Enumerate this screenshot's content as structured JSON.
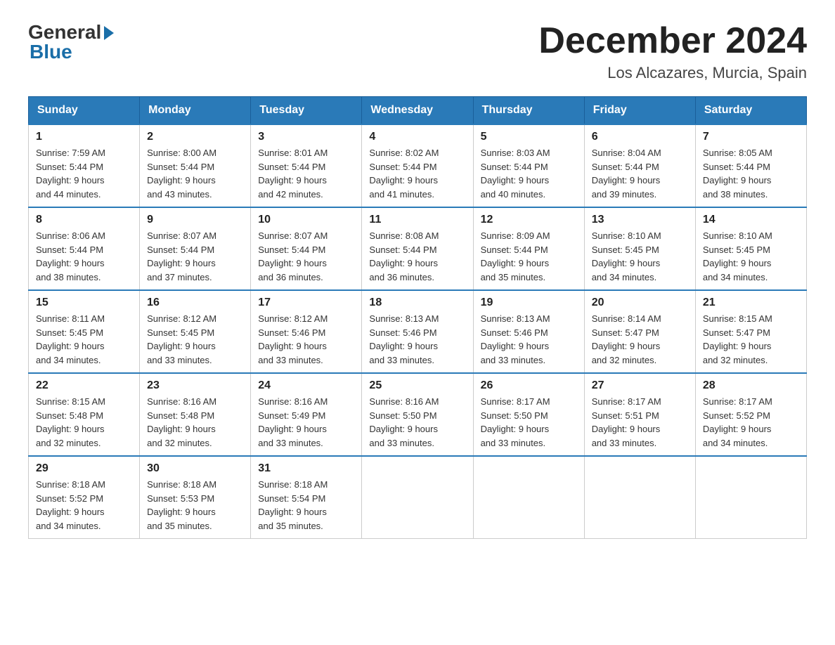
{
  "logo": {
    "general": "General",
    "blue": "Blue"
  },
  "header": {
    "month": "December 2024",
    "location": "Los Alcazares, Murcia, Spain"
  },
  "weekdays": [
    "Sunday",
    "Monday",
    "Tuesday",
    "Wednesday",
    "Thursday",
    "Friday",
    "Saturday"
  ],
  "weeks": [
    [
      {
        "day": "1",
        "sunrise": "7:59 AM",
        "sunset": "5:44 PM",
        "daylight": "9 hours and 44 minutes."
      },
      {
        "day": "2",
        "sunrise": "8:00 AM",
        "sunset": "5:44 PM",
        "daylight": "9 hours and 43 minutes."
      },
      {
        "day": "3",
        "sunrise": "8:01 AM",
        "sunset": "5:44 PM",
        "daylight": "9 hours and 42 minutes."
      },
      {
        "day": "4",
        "sunrise": "8:02 AM",
        "sunset": "5:44 PM",
        "daylight": "9 hours and 41 minutes."
      },
      {
        "day": "5",
        "sunrise": "8:03 AM",
        "sunset": "5:44 PM",
        "daylight": "9 hours and 40 minutes."
      },
      {
        "day": "6",
        "sunrise": "8:04 AM",
        "sunset": "5:44 PM",
        "daylight": "9 hours and 39 minutes."
      },
      {
        "day": "7",
        "sunrise": "8:05 AM",
        "sunset": "5:44 PM",
        "daylight": "9 hours and 38 minutes."
      }
    ],
    [
      {
        "day": "8",
        "sunrise": "8:06 AM",
        "sunset": "5:44 PM",
        "daylight": "9 hours and 38 minutes."
      },
      {
        "day": "9",
        "sunrise": "8:07 AM",
        "sunset": "5:44 PM",
        "daylight": "9 hours and 37 minutes."
      },
      {
        "day": "10",
        "sunrise": "8:07 AM",
        "sunset": "5:44 PM",
        "daylight": "9 hours and 36 minutes."
      },
      {
        "day": "11",
        "sunrise": "8:08 AM",
        "sunset": "5:44 PM",
        "daylight": "9 hours and 36 minutes."
      },
      {
        "day": "12",
        "sunrise": "8:09 AM",
        "sunset": "5:44 PM",
        "daylight": "9 hours and 35 minutes."
      },
      {
        "day": "13",
        "sunrise": "8:10 AM",
        "sunset": "5:45 PM",
        "daylight": "9 hours and 34 minutes."
      },
      {
        "day": "14",
        "sunrise": "8:10 AM",
        "sunset": "5:45 PM",
        "daylight": "9 hours and 34 minutes."
      }
    ],
    [
      {
        "day": "15",
        "sunrise": "8:11 AM",
        "sunset": "5:45 PM",
        "daylight": "9 hours and 34 minutes."
      },
      {
        "day": "16",
        "sunrise": "8:12 AM",
        "sunset": "5:45 PM",
        "daylight": "9 hours and 33 minutes."
      },
      {
        "day": "17",
        "sunrise": "8:12 AM",
        "sunset": "5:46 PM",
        "daylight": "9 hours and 33 minutes."
      },
      {
        "day": "18",
        "sunrise": "8:13 AM",
        "sunset": "5:46 PM",
        "daylight": "9 hours and 33 minutes."
      },
      {
        "day": "19",
        "sunrise": "8:13 AM",
        "sunset": "5:46 PM",
        "daylight": "9 hours and 33 minutes."
      },
      {
        "day": "20",
        "sunrise": "8:14 AM",
        "sunset": "5:47 PM",
        "daylight": "9 hours and 32 minutes."
      },
      {
        "day": "21",
        "sunrise": "8:15 AM",
        "sunset": "5:47 PM",
        "daylight": "9 hours and 32 minutes."
      }
    ],
    [
      {
        "day": "22",
        "sunrise": "8:15 AM",
        "sunset": "5:48 PM",
        "daylight": "9 hours and 32 minutes."
      },
      {
        "day": "23",
        "sunrise": "8:16 AM",
        "sunset": "5:48 PM",
        "daylight": "9 hours and 32 minutes."
      },
      {
        "day": "24",
        "sunrise": "8:16 AM",
        "sunset": "5:49 PM",
        "daylight": "9 hours and 33 minutes."
      },
      {
        "day": "25",
        "sunrise": "8:16 AM",
        "sunset": "5:50 PM",
        "daylight": "9 hours and 33 minutes."
      },
      {
        "day": "26",
        "sunrise": "8:17 AM",
        "sunset": "5:50 PM",
        "daylight": "9 hours and 33 minutes."
      },
      {
        "day": "27",
        "sunrise": "8:17 AM",
        "sunset": "5:51 PM",
        "daylight": "9 hours and 33 minutes."
      },
      {
        "day": "28",
        "sunrise": "8:17 AM",
        "sunset": "5:52 PM",
        "daylight": "9 hours and 34 minutes."
      }
    ],
    [
      {
        "day": "29",
        "sunrise": "8:18 AM",
        "sunset": "5:52 PM",
        "daylight": "9 hours and 34 minutes."
      },
      {
        "day": "30",
        "sunrise": "8:18 AM",
        "sunset": "5:53 PM",
        "daylight": "9 hours and 35 minutes."
      },
      {
        "day": "31",
        "sunrise": "8:18 AM",
        "sunset": "5:54 PM",
        "daylight": "9 hours and 35 minutes."
      },
      null,
      null,
      null,
      null
    ]
  ],
  "labels": {
    "sunrise": "Sunrise:",
    "sunset": "Sunset:",
    "daylight": "Daylight:"
  }
}
